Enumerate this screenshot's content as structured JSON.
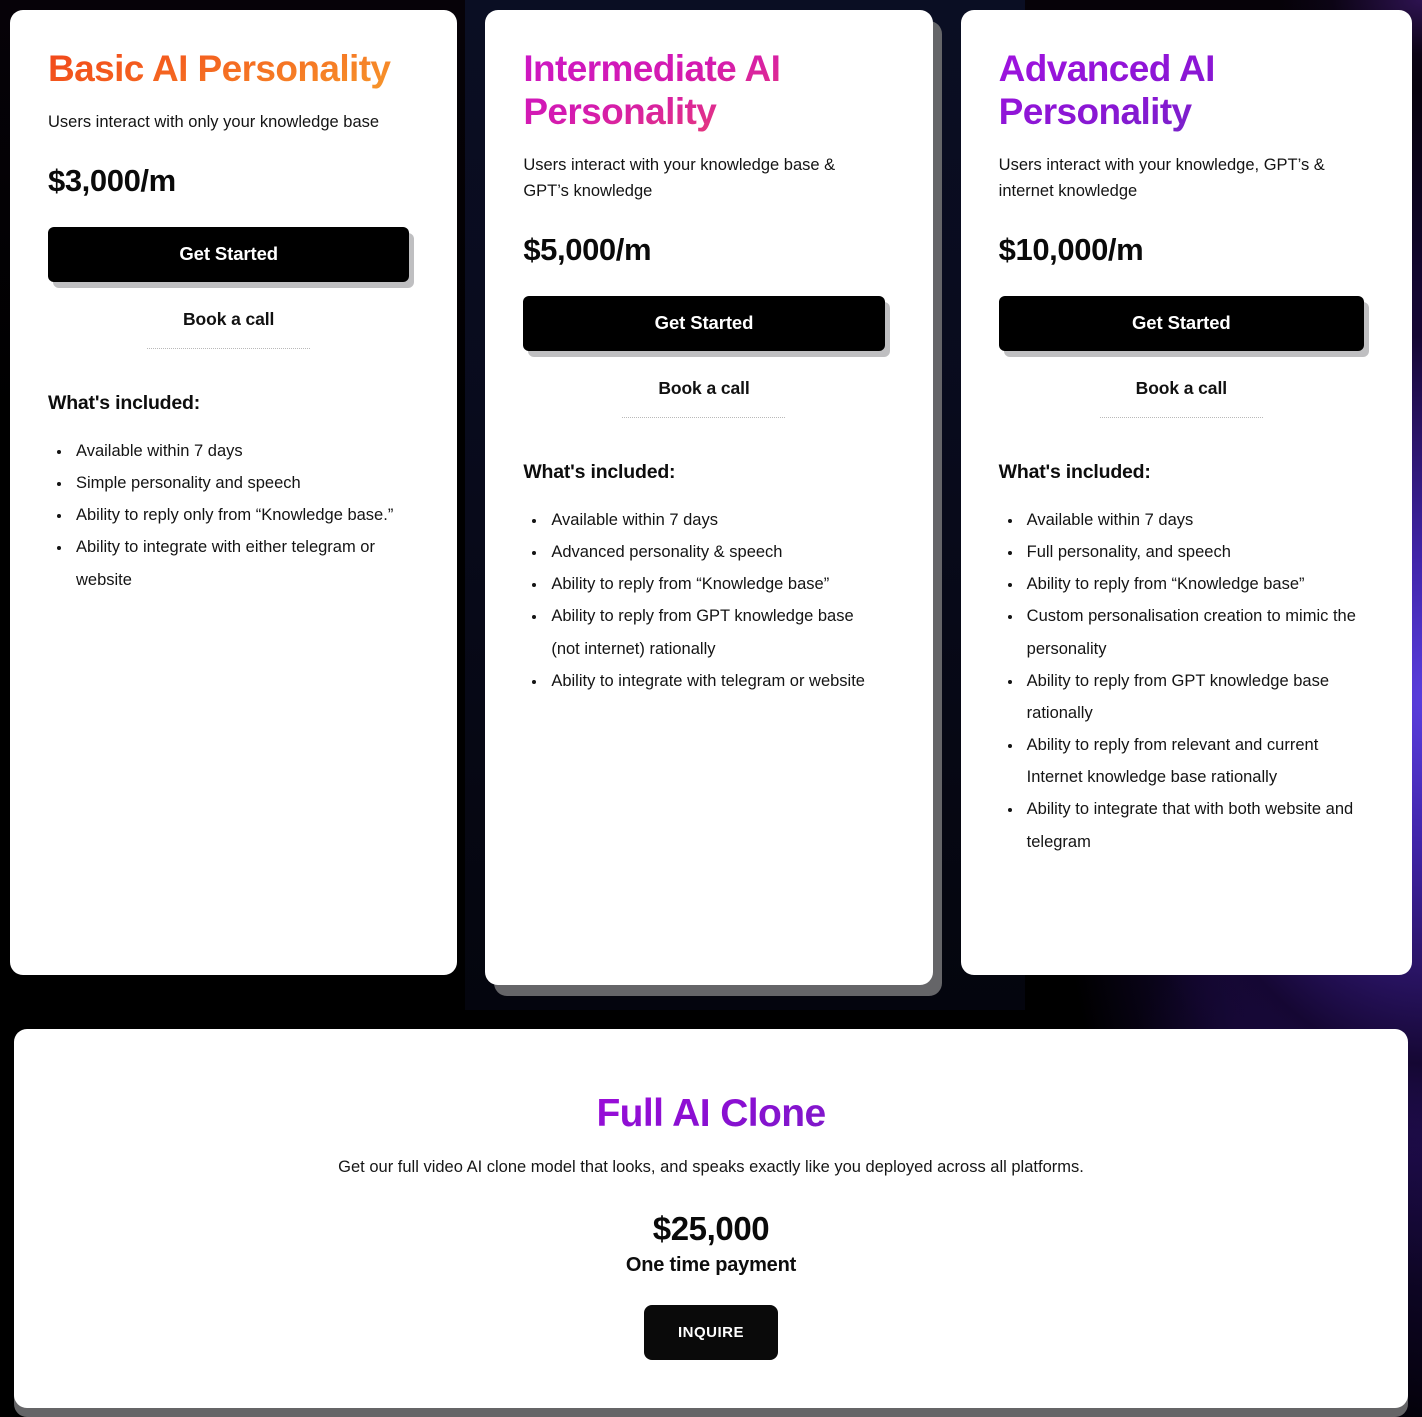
{
  "background": {
    "base_color": "#000000",
    "glow_color": "#4527d6",
    "glow_color_secondary": "#2d0f4d"
  },
  "plans": [
    {
      "title": "Basic AI Personality",
      "title_gradient_from": "#f1461a",
      "title_gradient_to": "#f79a2c",
      "subtitle": "Users interact with only your knowledge base",
      "price": "$3,000/m",
      "cta_label": "Get Started",
      "secondary_label": "Book a call",
      "included_label": "What's included:",
      "features": [
        "Available within 7 days",
        "Simple personality and speech",
        "Ability to reply only from “Knowledge base.”",
        "Ability to integrate with either telegram or website"
      ]
    },
    {
      "title": "Intermediate AI Personality",
      "title_gradient_from": "#cc17c8",
      "title_gradient_to": "#f2504f",
      "subtitle": "Users interact with your knowledge base & GPT’s knowledge",
      "price": "$5,000/m",
      "cta_label": "Get Started",
      "secondary_label": "Book a call",
      "included_label": "What's included:",
      "features": [
        "Available within 7 days",
        "Advanced personality & speech",
        "Ability to reply from “Knowledge base”",
        "Ability to reply from GPT knowledge base (not internet) rationally",
        "Ability to integrate with telegram or website"
      ]
    },
    {
      "title": "Advanced AI Personality",
      "title_gradient_from": "#a112e0",
      "title_gradient_to": "#6531bd",
      "subtitle": "Users interact with your knowledge, GPT’s & internet knowledge",
      "price": "$10,000/m",
      "cta_label": "Get Started",
      "secondary_label": "Book a call",
      "included_label": "What's included:",
      "features": [
        "Available within 7 days",
        "Full personality, and speech",
        "Ability to reply from “Knowledge base”",
        "Custom personalisation creation to mimic the personality",
        "Ability to reply from GPT knowledge base rationally",
        "Ability to reply from relevant and current Internet knowledge base rationally",
        "Ability to integrate that with both website and telegram"
      ]
    }
  ],
  "clone": {
    "title": "Full AI Clone",
    "title_gradient_from": "#9c0ed9",
    "title_gradient_to": "#7d1ac8",
    "description": "Get our full video AI clone model that looks, and speaks exactly like you deployed across all platforms.",
    "price": "$25,000",
    "payment_note": "One time payment",
    "cta_label": "INQUIRE"
  }
}
